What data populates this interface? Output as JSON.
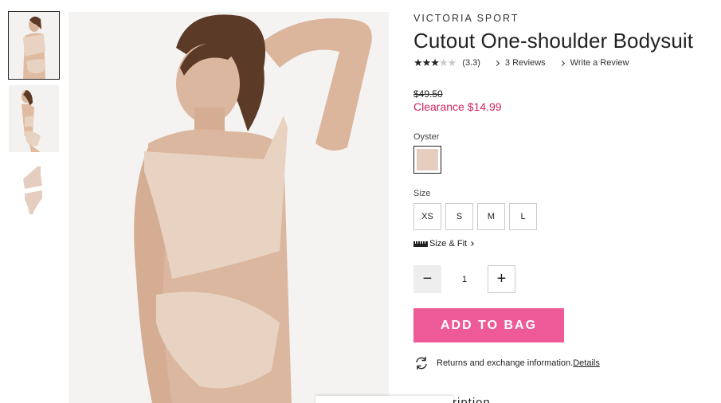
{
  "thumbnails": [
    {
      "name": "front view"
    },
    {
      "name": "back view"
    },
    {
      "name": "product view"
    }
  ],
  "product": {
    "brand": "VICTORIA SPORT",
    "title": "Cutout One-shoulder Bodysuit",
    "rating": 3.3,
    "rating_text": "(3.3)",
    "stars_filled": "★★★",
    "stars_empty": "★★",
    "reviews_link": "3 Reviews",
    "write_review_link": "Write a Review",
    "original_price": "$49.50",
    "sale_price": "Clearance $14.99",
    "color_label": "Oyster",
    "swatch_color": "#e5cdbf",
    "size_label": "Size",
    "sizes": [
      "XS",
      "S",
      "M",
      "L"
    ],
    "size_fit_link": "Size & Fit",
    "quantity": "1",
    "qty_minus": "−",
    "qty_plus": "+",
    "add_to_bag": "ADD TO BAG",
    "returns_text": "Returns and exchange information.",
    "details_link": "Details",
    "description_partial": "ription"
  },
  "colors": {
    "accent": "#ee5a98",
    "sale": "#d6245f"
  }
}
